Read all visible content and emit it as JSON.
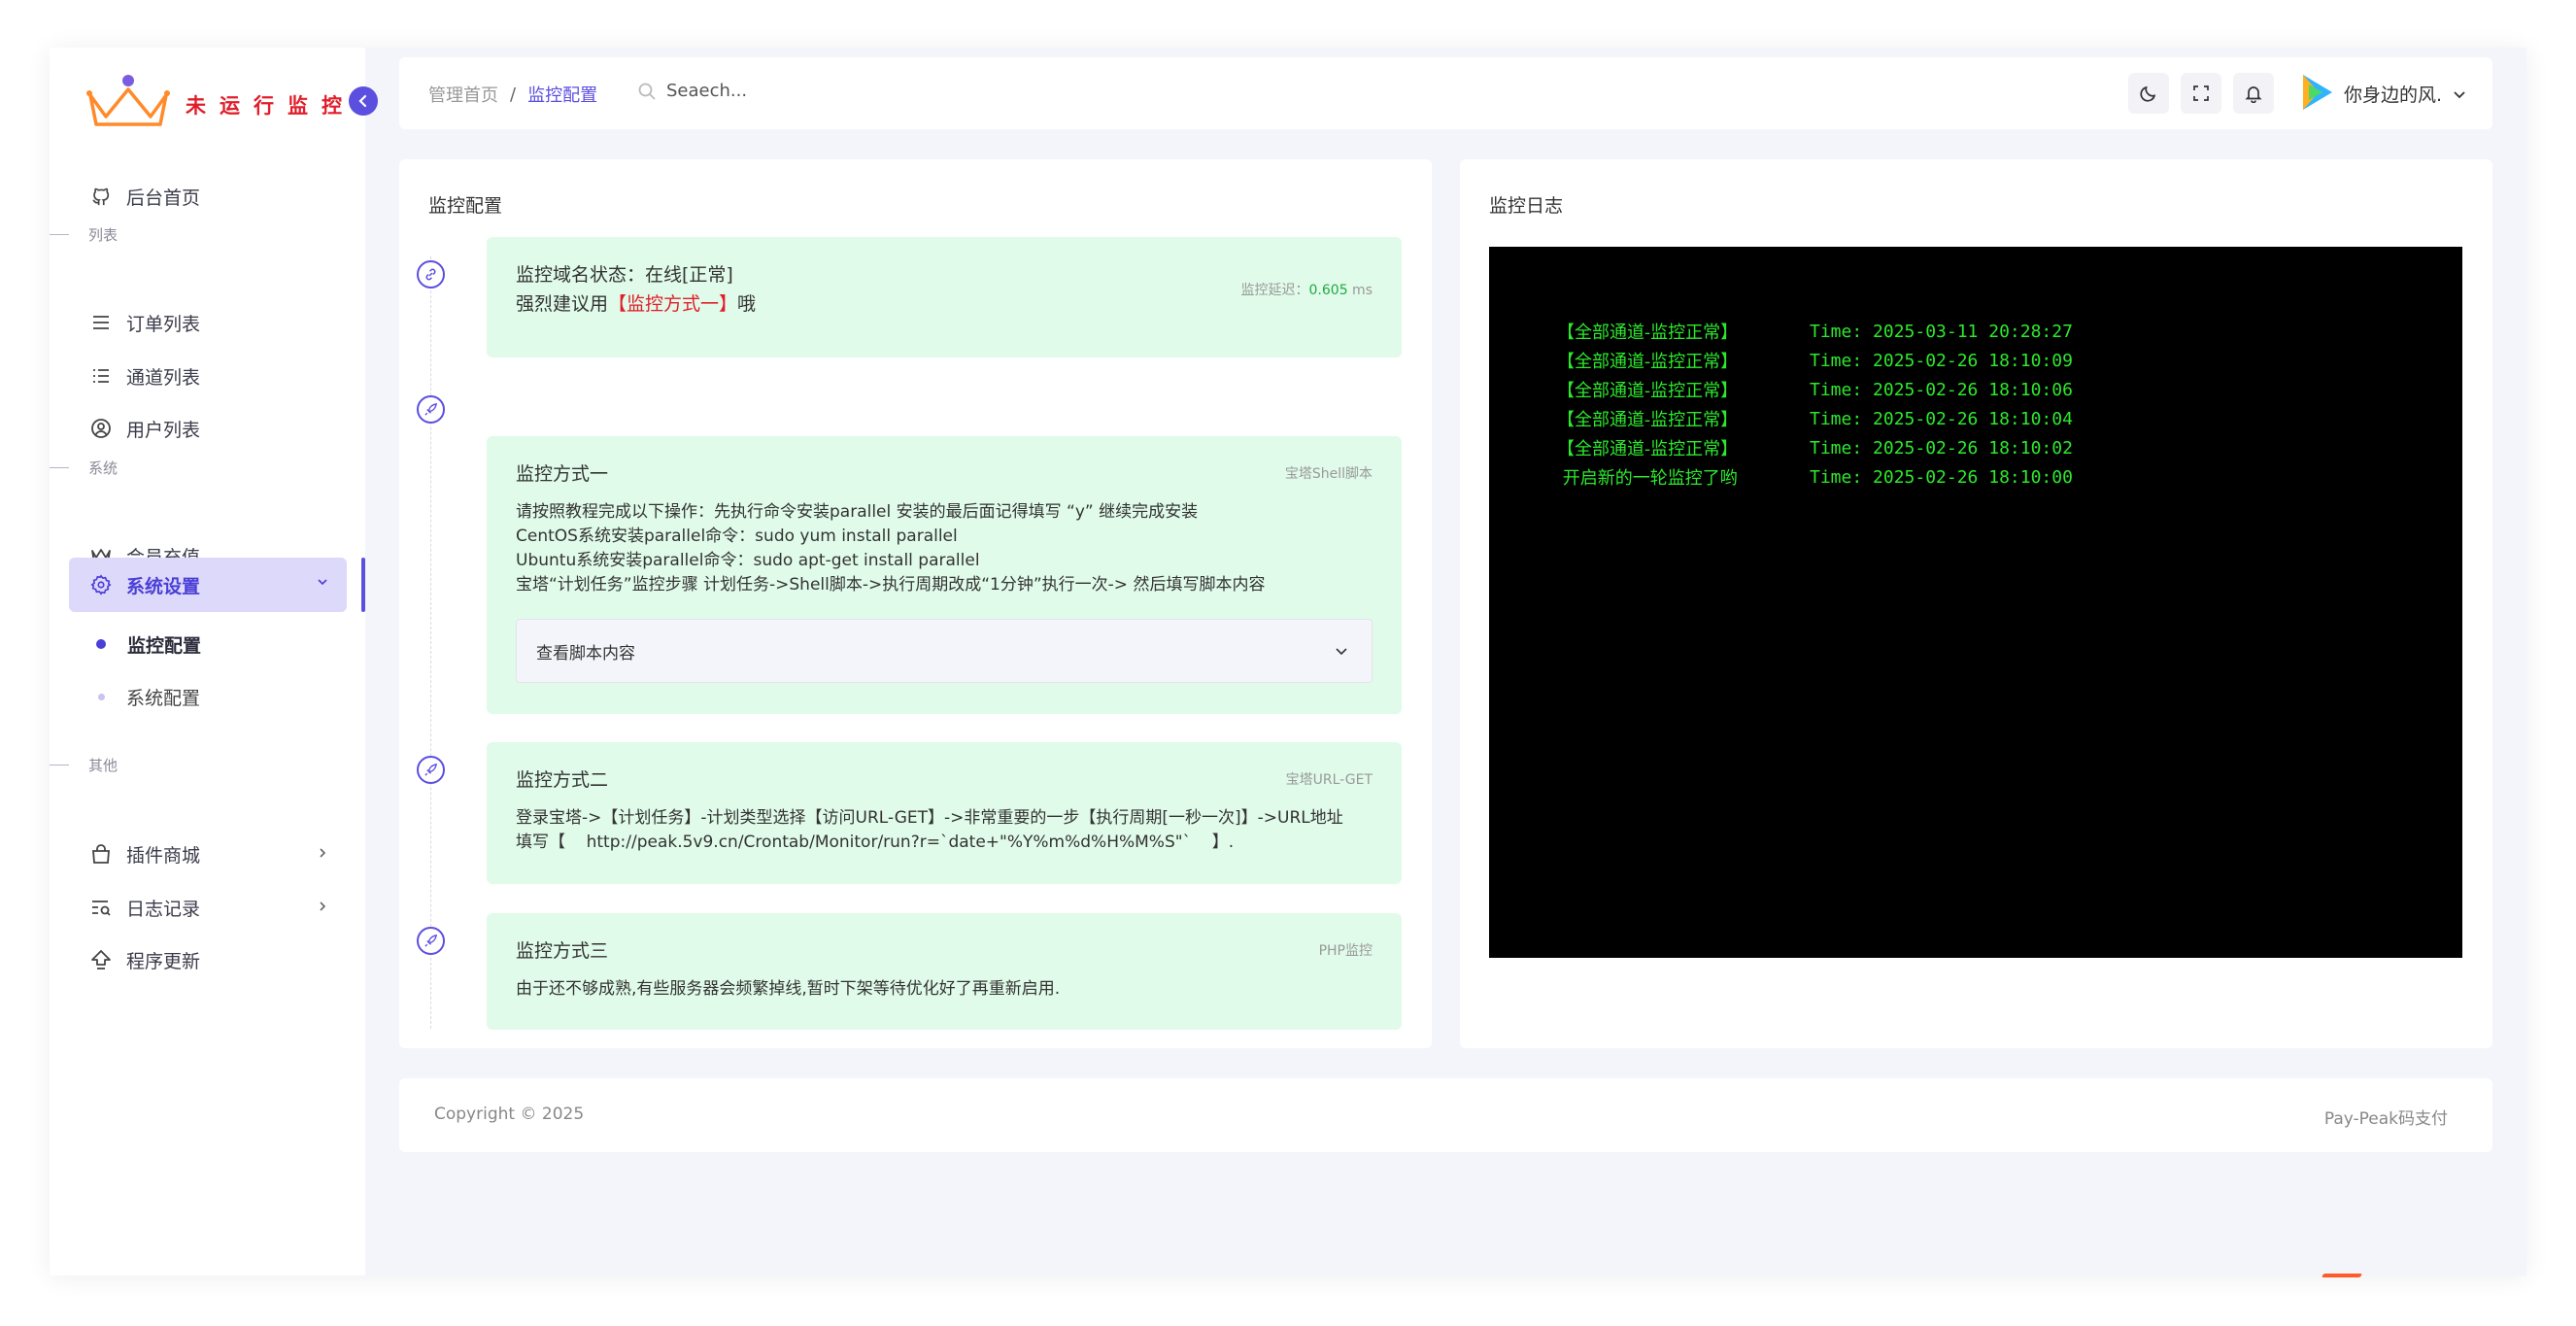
{
  "brand": {
    "title": "未运行监控"
  },
  "sidebar": {
    "home": "后台首页",
    "section_list": "列表",
    "orders": "订单列表",
    "channels": "通道列表",
    "users": "用户列表",
    "section_system": "系统",
    "recharge": "会员充值",
    "settings": "系统设置",
    "monitor_config": "监控配置",
    "system_config": "系统配置",
    "section_other": "其他",
    "plugins": "插件商城",
    "logs": "日志记录",
    "update": "程序更新"
  },
  "header": {
    "breadcrumb_home": "管理首页",
    "breadcrumb_sep": "/",
    "breadcrumb_current": "监控配置",
    "search_placeholder": "Seaech...",
    "username": "你身边的风."
  },
  "config": {
    "title": "监控配置",
    "status_line": "监控域名状态：在线[正常]",
    "suggest_prefix": "强烈建议用",
    "suggest_highlight": "【监控方式一】",
    "suggest_suffix": "哦",
    "latency_label": "监控延迟：",
    "latency_value": "0.605",
    "latency_unit": " ms",
    "method1": {
      "title": "监控方式一",
      "tag": "宝塔Shell脚本",
      "lines": [
        "请按照教程完成以下操作：先执行命令安装parallel 安装的最后面记得填写 “y” 继续完成安装",
        "CentOS系统安装parallel命令：sudo yum install parallel",
        "Ubuntu系统安装parallel命令：sudo apt-get install parallel",
        "宝塔“计划任务”监控步骤 计划任务->Shell脚本->执行周期改成“1分钟”执行一次-> 然后填写脚本内容"
      ],
      "collapse_label": "查看脚本内容"
    },
    "method2": {
      "title": "监控方式二",
      "tag": "宝塔URL-GET",
      "line1": "登录宝塔->【计划任务】-计划类型选择【访问URL-GET】->非常重要的一步【执行周期[一秒一次]】->URL地址",
      "line2": "填写【    http://peak.5v9.cn/Crontab/Monitor/run?r=`date+\"%Y%m%d%H%M%S\"`    】."
    },
    "method3": {
      "title": "监控方式三",
      "tag": "PHP监控",
      "line": "由于还不够成熟,有些服务器会频繁掉线,暂时下架等待优化好了再重新启用."
    }
  },
  "log": {
    "title": "监控日志",
    "entries": [
      {
        "msg": "【全部通道-监控正常】",
        "time": "Time: 2025-03-11 20:28:27"
      },
      {
        "msg": "【全部通道-监控正常】",
        "time": "Time: 2025-02-26 18:10:09"
      },
      {
        "msg": "【全部通道-监控正常】",
        "time": "Time: 2025-02-26 18:10:06"
      },
      {
        "msg": "【全部通道-监控正常】",
        "time": "Time: 2025-02-26 18:10:04"
      },
      {
        "msg": "【全部通道-监控正常】",
        "time": "Time: 2025-02-26 18:10:02"
      },
      {
        "msg": " 开启新的一轮监控了哟",
        "time": "Time: 2025-02-26 18:10:00"
      }
    ]
  },
  "footer": {
    "copyright": "Copyright © 2025",
    "brand": "Pay-Peak码支付"
  },
  "colors": {
    "accent": "#5b4fe0",
    "success_bg": "#e0fbe9",
    "log_text": "#2de82d",
    "brand_red": "#e11d2a"
  }
}
